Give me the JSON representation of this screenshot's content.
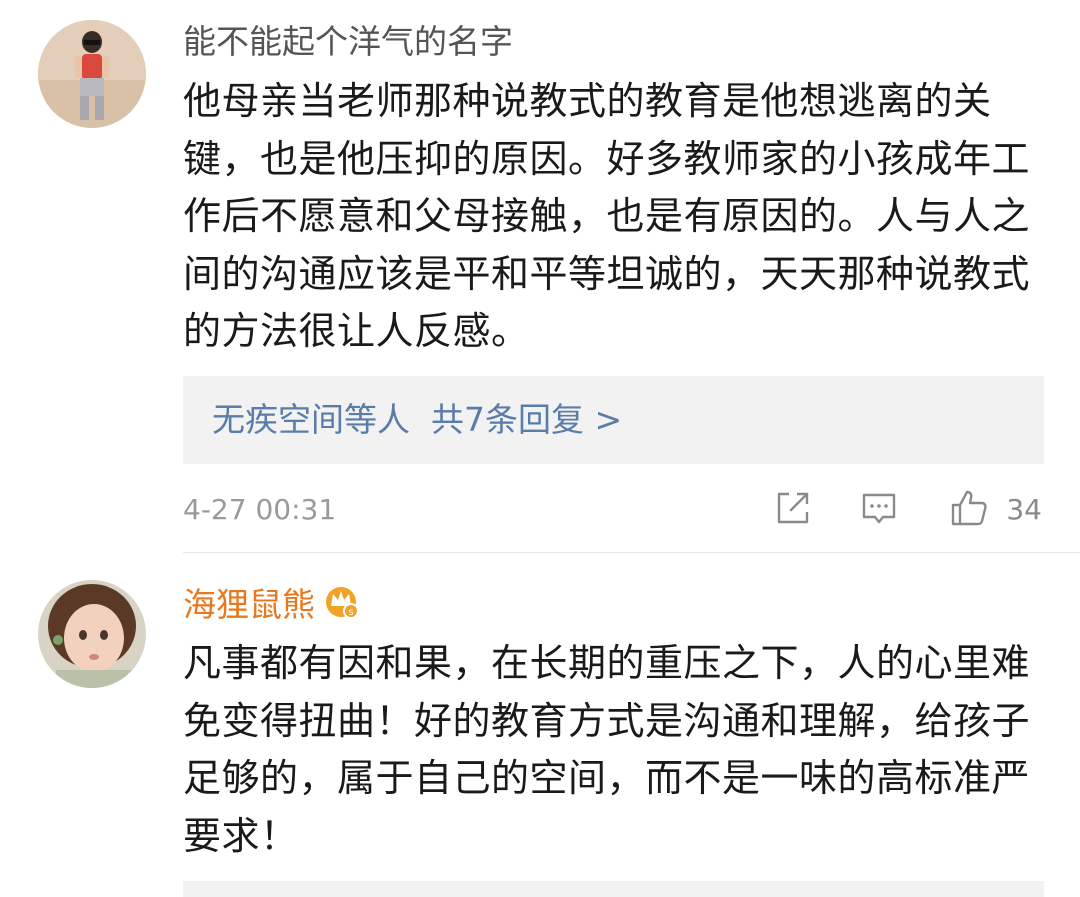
{
  "comments": [
    {
      "username": "能不能起个洋气的名字",
      "lines": [
        "他母亲当老师那种说教式的教育是他想逃离的关",
        "键，也是他压抑的原因。好多教师家的小孩成年工",
        "作后不愿意和父母接触，也是有原因的。人与人之",
        "间的沟通应该是平和平等坦诚的，天天那种说教式",
        "的方法很让人反感。"
      ],
      "reply_summary": "无疾空间等人  共7条回复 >",
      "timestamp": "4-27 00:31",
      "like_count": "34"
    },
    {
      "username": "海狸鼠熊",
      "lines": [
        "凡事都有因和果，在长期的重压之下，人的心里难",
        "免变得扭曲！好的教育方式是沟通和理解，给孩子",
        "足够的，属于自己的空间，而不是一味的高标准严",
        "要求！"
      ]
    }
  ],
  "colors": {
    "username_default": "#555555",
    "username_vip": "#e8781e",
    "reply_link": "#5a7ca8",
    "meta_gray": "#9a9a9a",
    "reply_bg": "#f2f2f2",
    "badge_gold": "#f0a326"
  },
  "icons": {
    "repost": "share-icon",
    "comment": "comment-icon",
    "like": "thumbs-up-icon",
    "vip": "vip-crown-badge-icon"
  }
}
